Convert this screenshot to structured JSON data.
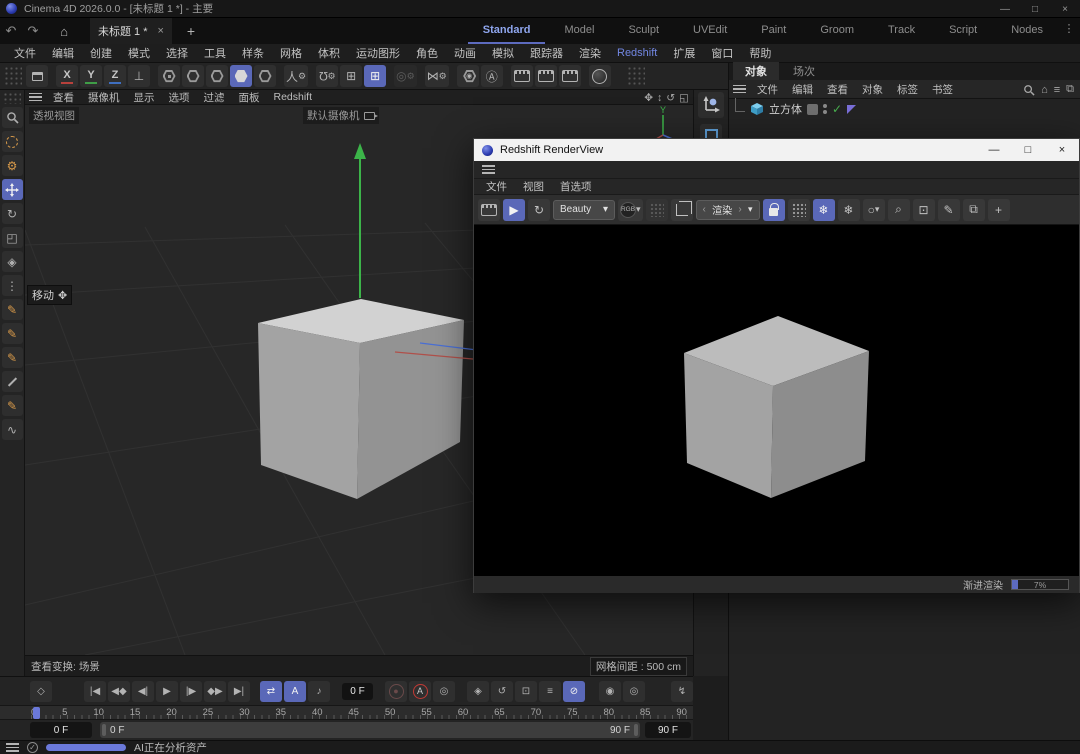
{
  "titlebar": {
    "title": "Cinema 4D 2026.0.0 - [未标题 1 *] - 主要"
  },
  "tabrow": {
    "doc_tab": "未标题 1 *",
    "layout_tabs": [
      "Standard",
      "Model",
      "Sculpt",
      "UVEdit",
      "Paint",
      "Groom",
      "Track",
      "Script",
      "Nodes"
    ],
    "active_layout_tab": "Standard"
  },
  "menubar": {
    "items": [
      "文件",
      "编辑",
      "创建",
      "模式",
      "选择",
      "工具",
      "样条",
      "网格",
      "体积",
      "运动图形",
      "角色",
      "动画",
      "模拟",
      "跟踪器",
      "渲染",
      "Redshift",
      "扩展",
      "窗口",
      "帮助"
    ],
    "accent_item": "Redshift"
  },
  "toolbar": {
    "axis_x": "X",
    "axis_y": "Y",
    "axis_z": "Z"
  },
  "viewport": {
    "menu": [
      "查看",
      "摄像机",
      "显示",
      "选项",
      "过滤",
      "面板",
      "Redshift"
    ],
    "view_label": "透视视图",
    "camera_label": "默认摄像机",
    "cursor_tooltip": "移动",
    "transform_info": "查看变换: 场景",
    "grid_spacing": "网格间距 : 500 cm"
  },
  "object_manager": {
    "tabs": [
      "对象",
      "场次"
    ],
    "active_tab": "对象",
    "menu": [
      "文件",
      "编辑",
      "查看",
      "对象",
      "标签",
      "书签"
    ],
    "objects": [
      {
        "name": "立方体"
      }
    ]
  },
  "renderview": {
    "title": "Redshift RenderView",
    "menu": [
      "文件",
      "视图",
      "首选项"
    ],
    "aov_dropdown": "Beauty",
    "channel_label": "RGB",
    "snapshot_dropdown": "渲染",
    "progress_label": "渐进渲染",
    "progress_percent": "7%"
  },
  "timeline": {
    "ruler_numbers": [
      "0",
      "5",
      "10",
      "15",
      "20",
      "25",
      "30",
      "35",
      "40",
      "45",
      "50",
      "55",
      "60",
      "65",
      "70",
      "75",
      "80",
      "85",
      "90"
    ],
    "current_frame": "0 F",
    "range_start_field": "0 F",
    "range_end_field": "90 F",
    "range_bar_start": "0 F",
    "range_bar_end": "90 F"
  },
  "statusbar": {
    "message": "AI正在分析资产"
  },
  "colors": {
    "accent_blue": "#5a68b8",
    "axis_green": "#3cb449",
    "axis_red": "#b0504a",
    "axis_blue": "#4a6fd4",
    "autokey_red": "#c33a35",
    "check_green": "#49b04f",
    "tag_purple": "#7a6fd8"
  },
  "icons": {
    "undo": "↶",
    "redo": "↷",
    "home": "⌂",
    "tab_close": "×",
    "tab_add": "+",
    "minimize": "—",
    "maximize": "□",
    "close": "×",
    "axis_tool": "⊥",
    "gear": "⚙",
    "magnet": "Ω",
    "snap_grid": "⊞",
    "falloff": "◎",
    "symmetry": "⋈",
    "solo": "◉",
    "axis_lock": "Ⓐ",
    "hand": "✥",
    "dolly": "↕",
    "orbit": "↺",
    "panel_toggle": "◱",
    "go_start": "|◀",
    "prev_key": "◀◆",
    "prev_frame": "◀|",
    "play": "▶",
    "next_frame": "|▶",
    "next_key": "◆▶",
    "go_end": "▶|",
    "loop": "⇄",
    "autokey_tracks": "A",
    "speaker": "♪",
    "record": "●",
    "autokey": "A",
    "key_settings": "◎",
    "kf_position": "◈",
    "kf_rotation": "↺",
    "kf_scale": "⊡",
    "kf_params": "≡",
    "kf_off": "⊘",
    "mouse_rec_1": "◉",
    "mouse_rec_2": "◎",
    "fcurve": "↯",
    "keyframe_diamond": "◇",
    "refresh": "↻",
    "dropdown_arrow": "▾",
    "angle_left": "‹",
    "angle_right": "›",
    "snowflake": "❄",
    "snowflake_g": "❄",
    "ipr_circle": "○",
    "focus": "⌕",
    "fit_image": "⊡",
    "pencil": "✎",
    "compare": "⧉",
    "add_image": "+",
    "search": "Q",
    "filter": "≡",
    "new_window": "⧉",
    "check": "✓",
    "rotate_tool": "↻",
    "scale_tool": "◰",
    "move_tool": "+",
    "tweak": "⚙",
    "pen": "✎",
    "sketch": "∿",
    "dots3": "⋮"
  }
}
